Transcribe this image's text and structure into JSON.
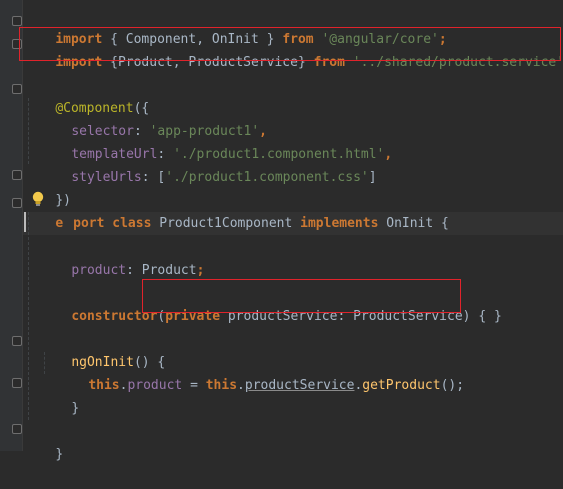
{
  "code": {
    "l1": {
      "kw_import": "import",
      "brace_open": " { ",
      "name1": "Component",
      "comma": ", ",
      "name2": "OnInit",
      "brace_close": " } ",
      "kw_from": "from",
      "sp": " ",
      "path": "'@angular/core'",
      "semi": ";"
    },
    "l2": {
      "kw_import": "import",
      "brace_open": " {",
      "name1": "Product",
      "comma": ", ",
      "name2": "ProductService",
      "brace_close": "} ",
      "kw_from": "from",
      "sp": " ",
      "path": "'../shared/product.service'",
      "semi": ";"
    },
    "l4": {
      "ann": "@Component",
      "open": "({"
    },
    "l5": {
      "prop": "selector",
      "colon": ": ",
      "val": "'app-product1'",
      "comma": ","
    },
    "l6": {
      "prop": "templateUrl",
      "colon": ": ",
      "val": "'./product1.component.html'",
      "comma": ","
    },
    "l7": {
      "prop": "styleUrls",
      "colon": ": [",
      "val": "'./product1.component.css'",
      "close": "]"
    },
    "l8": {
      "close": "})"
    },
    "l9": {
      "kw_export_a": "e",
      "kw_export_b": "port",
      "sp1": " ",
      "kw_class": "class",
      "sp2": " ",
      "name": "Product1Component",
      "sp3": " ",
      "kw_impl": "implements",
      "sp4": " ",
      "iface": "OnInit",
      "open": " {"
    },
    "l11": {
      "prop": "product",
      "colon": ": ",
      "type": "Product",
      "semi": ";"
    },
    "l13": {
      "kw_ctor": "constructor",
      "paren": "(",
      "kw_private": "private",
      "sp": " ",
      "param": "productService",
      "colon": ": ",
      "type": "ProductService",
      "close": ") { }"
    },
    "l15": {
      "fn": "ngOnInit",
      "rest": "() {"
    },
    "l16": {
      "kw_this1": "this",
      "dot1": ".",
      "prop": "product",
      "eq": " = ",
      "kw_this2": "this",
      "dot2": ".",
      "svc": "productService",
      "dot3": ".",
      "fn": "getProduct",
      "end": "();"
    },
    "l17": {
      "close": "}"
    },
    "l19": {
      "close": "}"
    }
  }
}
